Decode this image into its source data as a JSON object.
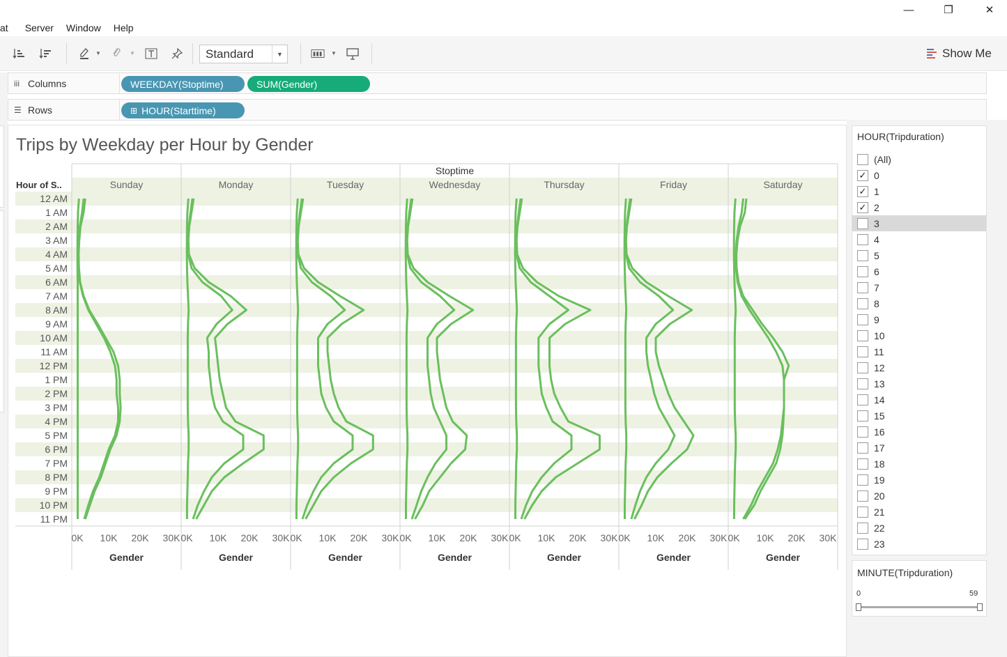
{
  "window": {
    "minimize": "—",
    "restore": "❐",
    "close": "✕"
  },
  "menu": [
    "at",
    "Server",
    "Window",
    "Help"
  ],
  "toolbar": {
    "mark_size_select": "Standard",
    "show_me_label": "Show Me",
    "icons": [
      "sort-ascending-icon",
      "sort-descending-icon",
      "highlight-icon",
      "annotate-icon",
      "text-label-icon",
      "pin-icon",
      "fit-icon",
      "presentation-icon"
    ]
  },
  "shelves": {
    "columns_label": "Columns",
    "rows_label": "Rows",
    "columns_pills": [
      "WEEKDAY(Stoptime)",
      "SUM(Gender)"
    ],
    "rows_pills": [
      "HOUR(Starttime)"
    ],
    "rows_pill_prefix": "⊞"
  },
  "colors": {
    "line": "#6abf5e",
    "band": "#eef2e3",
    "pill_blue": "#4996b2",
    "pill_green": "#16ab78"
  },
  "sheet": {
    "title": "Trips by Weekday per Hour by Gender",
    "column_header": "Stoptime",
    "row_header": "Hour of S.."
  },
  "chart_data": {
    "type": "line",
    "title": "Trips by Weekday per Hour by Gender",
    "panels": [
      "Sunday",
      "Monday",
      "Tuesday",
      "Wednesday",
      "Thursday",
      "Friday",
      "Saturday"
    ],
    "hours": [
      "12 AM",
      "1 AM",
      "2 AM",
      "3 AM",
      "4 AM",
      "5 AM",
      "6 AM",
      "7 AM",
      "8 AM",
      "9 AM",
      "10 AM",
      "11 AM",
      "12 PM",
      "1 PM",
      "2 PM",
      "3 PM",
      "4 PM",
      "5 PM",
      "6 PM",
      "7 PM",
      "8 PM",
      "9 PM",
      "10 PM",
      "11 PM"
    ],
    "x_ticks": [
      "0K",
      "10K",
      "20K",
      "30K"
    ],
    "xlim": [
      0,
      30000
    ],
    "xlabel": "Gender",
    "series": [
      {
        "values": [
          [
            500,
            200,
            100,
            50,
            50,
            50,
            100,
            100,
            100,
            100,
            100,
            100,
            100,
            100,
            100,
            100,
            100,
            100,
            100,
            100,
            100,
            100,
            100,
            100
          ],
          [
            500,
            200,
            100,
            50,
            50,
            100,
            200,
            400,
            600,
            400,
            300,
            300,
            300,
            300,
            300,
            300,
            400,
            600,
            600,
            400,
            300,
            200,
            100,
            100
          ],
          [
            500,
            200,
            100,
            50,
            50,
            100,
            200,
            400,
            600,
            400,
            300,
            300,
            300,
            300,
            300,
            300,
            400,
            600,
            600,
            400,
            300,
            200,
            100,
            100
          ],
          [
            500,
            200,
            100,
            50,
            50,
            100,
            200,
            400,
            600,
            400,
            300,
            300,
            300,
            300,
            300,
            300,
            400,
            600,
            600,
            400,
            300,
            200,
            100,
            100
          ],
          [
            500,
            200,
            100,
            50,
            50,
            100,
            200,
            400,
            600,
            400,
            300,
            300,
            300,
            300,
            300,
            300,
            400,
            600,
            600,
            400,
            300,
            200,
            100,
            100
          ],
          [
            500,
            200,
            100,
            50,
            50,
            100,
            200,
            400,
            600,
            400,
            300,
            300,
            300,
            300,
            300,
            300,
            400,
            600,
            600,
            400,
            300,
            200,
            100,
            100
          ],
          [
            500,
            200,
            100,
            50,
            50,
            100,
            200,
            400,
            600,
            400,
            300,
            300,
            300,
            300,
            300,
            300,
            400,
            600,
            600,
            400,
            300,
            200,
            100,
            100
          ]
        ]
      },
      {
        "values": [
          [
            2000,
            1500,
            800,
            500,
            300,
            400,
            800,
            1800,
            3500,
            6000,
            8500,
            10500,
            12000,
            12500,
            12500,
            13000,
            13000,
            12000,
            10000,
            8500,
            7000,
            5000,
            3500,
            2200
          ],
          [
            1800,
            1200,
            700,
            400,
            500,
            1500,
            5000,
            11000,
            14500,
            9500,
            6500,
            7000,
            7000,
            7500,
            8000,
            9000,
            11500,
            18000,
            18000,
            12000,
            8000,
            5500,
            3500,
            2000
          ],
          [
            1800,
            1200,
            700,
            400,
            500,
            1500,
            5000,
            11000,
            15500,
            10000,
            7000,
            7000,
            7000,
            7500,
            8000,
            9500,
            12000,
            18000,
            18000,
            12000,
            8000,
            5500,
            3500,
            2000
          ],
          [
            1800,
            1200,
            700,
            400,
            500,
            1500,
            5000,
            11000,
            15500,
            10000,
            7000,
            7000,
            7000,
            7500,
            8000,
            9000,
            11000,
            13000,
            13000,
            9500,
            7000,
            5000,
            3500,
            2000
          ],
          [
            1800,
            1200,
            700,
            400,
            500,
            1500,
            5000,
            11000,
            17000,
            11000,
            7500,
            7500,
            7500,
            8000,
            8500,
            10000,
            12000,
            18000,
            18000,
            12500,
            8500,
            5500,
            3500,
            2000
          ],
          [
            1800,
            1200,
            700,
            400,
            500,
            1500,
            5000,
            11000,
            15500,
            10000,
            7000,
            7000,
            7500,
            8500,
            9500,
            11000,
            13500,
            16000,
            14000,
            10000,
            7000,
            5000,
            3500,
            2200
          ],
          [
            3000,
            2500,
            1500,
            900,
            600,
            700,
            1200,
            2500,
            5000,
            8000,
            11000,
            13500,
            15500,
            16000,
            16000,
            16000,
            15500,
            15000,
            14000,
            12500,
            10000,
            7500,
            5500,
            3000
          ]
        ]
      },
      {
        "values": [
          [
            2500,
            2000,
            1000,
            600,
            400,
            500,
            900,
            2000,
            3800,
            6500,
            9000,
            11500,
            13000,
            13500,
            13500,
            13800,
            13500,
            12500,
            10500,
            9000,
            7500,
            5500,
            4000,
            2500
          ],
          [
            2200,
            1500,
            800,
            500,
            700,
            2500,
            7000,
            14000,
            19000,
            13000,
            9000,
            9500,
            10000,
            10500,
            11500,
            12500,
            15500,
            24500,
            24500,
            18000,
            12000,
            8000,
            5500,
            3000
          ],
          [
            2200,
            1500,
            800,
            500,
            700,
            2500,
            7000,
            14000,
            21500,
            14500,
            10000,
            10000,
            10500,
            11000,
            12000,
            13500,
            16000,
            24500,
            24500,
            17500,
            12000,
            8000,
            5500,
            3000
          ],
          [
            2200,
            1500,
            800,
            500,
            700,
            2500,
            7000,
            14000,
            21500,
            14500,
            10000,
            10000,
            10500,
            11000,
            12000,
            13000,
            15000,
            19500,
            19000,
            14500,
            11000,
            7500,
            5500,
            3000
          ],
          [
            2200,
            1500,
            800,
            500,
            700,
            2500,
            7000,
            14000,
            24000,
            16000,
            11000,
            11000,
            11000,
            11500,
            12500,
            14500,
            17000,
            27000,
            27000,
            20000,
            13000,
            8500,
            5500,
            3000
          ],
          [
            2200,
            1500,
            800,
            500,
            700,
            2500,
            7000,
            14000,
            21500,
            14500,
            10000,
            10000,
            11000,
            12500,
            14000,
            16000,
            19000,
            22000,
            20000,
            15000,
            10500,
            7500,
            5500,
            3200
          ],
          [
            4000,
            3500,
            2000,
            1200,
            800,
            900,
            1500,
            3000,
            6000,
            9000,
            12500,
            15500,
            17500,
            16000,
            16000,
            16000,
            15800,
            15500,
            14800,
            13500,
            11000,
            8500,
            6500,
            3500
          ]
        ]
      }
    ]
  },
  "filter_hour": {
    "title": "HOUR(Tripduration)",
    "items": [
      {
        "label": "(All)",
        "checked": false
      },
      {
        "label": "0",
        "checked": true
      },
      {
        "label": "1",
        "checked": true
      },
      {
        "label": "2",
        "checked": true
      },
      {
        "label": "3",
        "checked": false,
        "highlighted": true
      },
      {
        "label": "4",
        "checked": false
      },
      {
        "label": "5",
        "checked": false
      },
      {
        "label": "6",
        "checked": false
      },
      {
        "label": "7",
        "checked": false
      },
      {
        "label": "8",
        "checked": false
      },
      {
        "label": "9",
        "checked": false
      },
      {
        "label": "10",
        "checked": false
      },
      {
        "label": "11",
        "checked": false
      },
      {
        "label": "12",
        "checked": false
      },
      {
        "label": "13",
        "checked": false
      },
      {
        "label": "14",
        "checked": false
      },
      {
        "label": "15",
        "checked": false
      },
      {
        "label": "16",
        "checked": false
      },
      {
        "label": "17",
        "checked": false
      },
      {
        "label": "18",
        "checked": false
      },
      {
        "label": "19",
        "checked": false
      },
      {
        "label": "20",
        "checked": false
      },
      {
        "label": "21",
        "checked": false
      },
      {
        "label": "22",
        "checked": false
      },
      {
        "label": "23",
        "checked": false
      }
    ]
  },
  "filter_minute": {
    "title": "MINUTE(Tripduration)",
    "min_label": "0",
    "max_label": "59",
    "range": [
      0,
      59
    ]
  }
}
